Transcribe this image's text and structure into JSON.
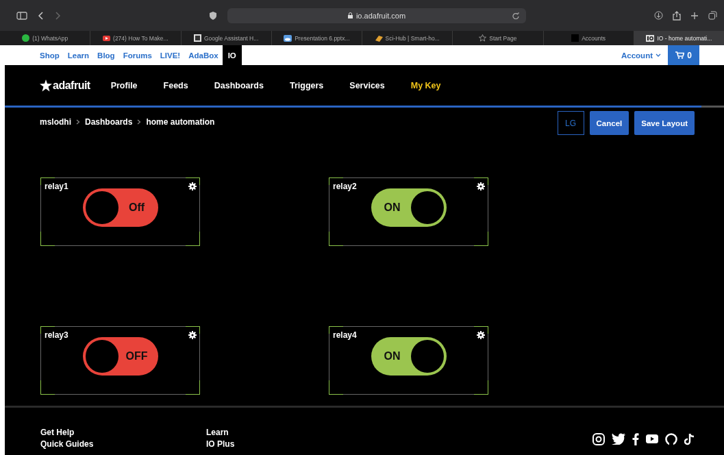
{
  "browser": {
    "url": "io.adafruit.com",
    "bookmarks": [
      {
        "label": "(1) WhatsApp",
        "kind": "whatsapp",
        "selected": false
      },
      {
        "label": "(274) How To Make...",
        "kind": "youtube",
        "selected": false
      },
      {
        "label": "Google Assistant H...",
        "kind": "ic",
        "selected": false
      },
      {
        "label": "Presentation 6.pptx...",
        "kind": "cloud",
        "selected": false
      },
      {
        "label": "Sci-Hub | Smart-ho...",
        "kind": "scihub",
        "selected": false
      },
      {
        "label": "Start Page",
        "kind": "star",
        "selected": false
      },
      {
        "label": "Accounts",
        "kind": "square",
        "selected": false
      },
      {
        "label": "IO - home automati...",
        "kind": "io",
        "selected": true
      }
    ]
  },
  "top_links": [
    {
      "label": "Shop",
      "selected": false
    },
    {
      "label": "Learn",
      "selected": false
    },
    {
      "label": "Blog",
      "selected": false
    },
    {
      "label": "Forums",
      "selected": false
    },
    {
      "label": "LIVE!",
      "selected": false
    },
    {
      "label": "AdaBox",
      "selected": false
    },
    {
      "label": "IO",
      "selected": true
    }
  ],
  "account": {
    "label": "Account",
    "cart_count": "0"
  },
  "nav": {
    "logo": "adafruit",
    "items": [
      {
        "label": "Profile",
        "highlight": false
      },
      {
        "label": "Feeds",
        "highlight": false
      },
      {
        "label": "Dashboards",
        "highlight": false
      },
      {
        "label": "Triggers",
        "highlight": false
      },
      {
        "label": "Services",
        "highlight": false
      },
      {
        "label": "My Key",
        "highlight": true
      }
    ]
  },
  "breadcrumbs": [
    "mslodhi",
    "Dashboards",
    "home automation"
  ],
  "actions": {
    "size": "LG",
    "cancel": "Cancel",
    "save": "Save Layout"
  },
  "blocks": [
    {
      "title": "relay1",
      "on": false,
      "label": "Off"
    },
    {
      "title": "relay2",
      "on": true,
      "label": "ON"
    },
    {
      "title": "relay3",
      "on": false,
      "label": "OFF"
    },
    {
      "title": "relay4",
      "on": true,
      "label": "ON"
    }
  ],
  "footer": {
    "columns": [
      [
        "Get Help",
        "Quick Guides"
      ],
      [
        "Learn",
        "IO Plus"
      ]
    ]
  }
}
